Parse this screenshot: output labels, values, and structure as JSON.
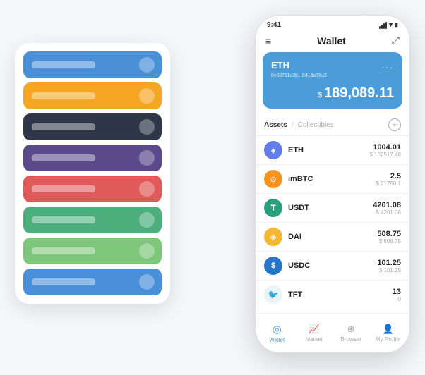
{
  "scene": {
    "background": "#f5f7fa"
  },
  "cardStack": {
    "cards": [
      {
        "color": "card-blue",
        "label": "",
        "id": "blue1"
      },
      {
        "color": "card-yellow",
        "label": "",
        "id": "yellow"
      },
      {
        "color": "card-dark",
        "label": "",
        "id": "dark"
      },
      {
        "color": "card-purple",
        "label": "",
        "id": "purple"
      },
      {
        "color": "card-red",
        "label": "",
        "id": "red"
      },
      {
        "color": "card-green",
        "label": "",
        "id": "green"
      },
      {
        "color": "card-light-green",
        "label": "",
        "id": "lightgreen"
      },
      {
        "color": "card-blue2",
        "label": "",
        "id": "blue2"
      }
    ]
  },
  "phone": {
    "statusBar": {
      "time": "9:41"
    },
    "header": {
      "title": "Wallet"
    },
    "ethCard": {
      "name": "ETH",
      "address": "0x08711d3b...8418a78u3",
      "balanceCurrency": "$",
      "balance": "189,089.11",
      "menuDots": "..."
    },
    "assets": {
      "tabActive": "Assets",
      "divider": "/",
      "tabInactive": "Collectibles",
      "addLabel": "+"
    },
    "assetList": [
      {
        "name": "ETH",
        "icon": "♦",
        "iconBg": "#627eea",
        "amount": "1004.01",
        "usd": "$ 162517.48"
      },
      {
        "name": "imBTC",
        "icon": "⊙",
        "iconBg": "#f7931a",
        "amount": "2.5",
        "usd": "$ 21760.1"
      },
      {
        "name": "USDT",
        "icon": "T",
        "iconBg": "#26a17b",
        "amount": "4201.08",
        "usd": "$ 4201.08"
      },
      {
        "name": "DAI",
        "icon": "◈",
        "iconBg": "#f4b731",
        "amount": "508.75",
        "usd": "$ 508.75"
      },
      {
        "name": "USDC",
        "icon": "$",
        "iconBg": "#2775ca",
        "amount": "101.25",
        "usd": "$ 101.25"
      },
      {
        "name": "TFT",
        "icon": "🐦",
        "iconBg": "#e8f4f8",
        "amount": "13",
        "usd": "0"
      }
    ],
    "bottomNav": [
      {
        "label": "Wallet",
        "icon": "◎",
        "active": true
      },
      {
        "label": "Market",
        "icon": "📊",
        "active": false
      },
      {
        "label": "Browser",
        "icon": "👤",
        "active": false
      },
      {
        "label": "My Profile",
        "icon": "👤",
        "active": false
      }
    ]
  }
}
